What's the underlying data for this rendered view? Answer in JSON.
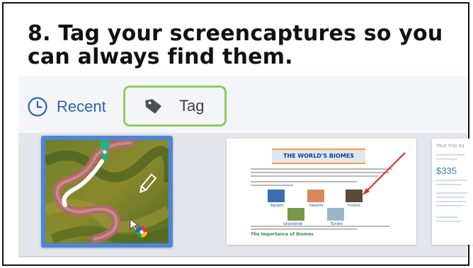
{
  "slide": {
    "headline_line1": "8. Tag your screencaptures so you",
    "headline_line2": "can always find them."
  },
  "toolbar": {
    "recent_label": "Recent",
    "recent_icon": "clock-icon",
    "tag_label": "Tag",
    "tag_icon": "tag-icon",
    "highlight_color": "#8ccc5b"
  },
  "tray": {
    "thumbnails": [
      {
        "kind": "aerial-river-photo",
        "selected": true
      },
      {
        "kind": "document",
        "title": "THE WORLD'S BIOMES",
        "biomes": [
          "Aquatic",
          "Deserts",
          "Forests",
          "Grasslands",
          "Tundra"
        ],
        "footer_heading": "The Importance of Biomes"
      },
      {
        "kind": "web-page",
        "title": "Your trip su",
        "price": "$335"
      }
    ]
  }
}
